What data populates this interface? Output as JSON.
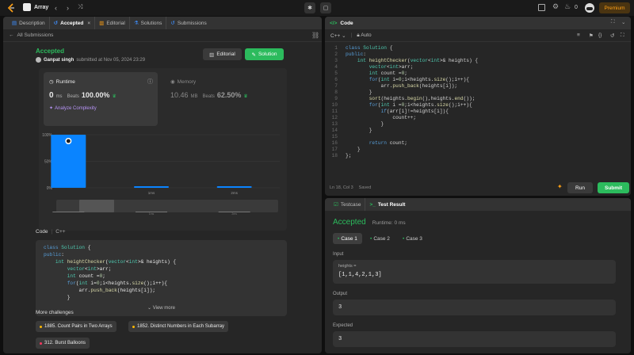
{
  "topbar": {
    "problem_list_label": "Array",
    "premium_label": "Premium",
    "fire_count": "0"
  },
  "left_panel": {
    "tabs": [
      {
        "label": "Description"
      },
      {
        "label": "Accepted"
      },
      {
        "label": "Editorial"
      },
      {
        "label": "Solutions"
      },
      {
        "label": "Submissions"
      }
    ],
    "back_label": "All Submissions",
    "status": "Accepted",
    "author": "Ganpat singh",
    "submitted_at": "submitted at Nov 05, 2024 23:29",
    "editorial_button": "Editorial",
    "solution_button": "Solution",
    "runtime": {
      "title": "Runtime",
      "value": "0",
      "unit": "ms",
      "beats_label": "Beats",
      "beats_value": "100.00%",
      "analyze_label": "Analyze Complexity"
    },
    "memory": {
      "title": "Memory",
      "value": "10.46",
      "unit": "MB",
      "beats_label": "Beats",
      "beats_value": "62.50%"
    },
    "code_label": "Code",
    "language": "C++",
    "code_preview": [
      "class Solution {",
      "public:",
      "    int heightChecker(vector<int>& heights) {",
      "        vector<int>arr;",
      "        int count =0;",
      "        for(int i=0;i<heights.size();i++){",
      "            arr.push_back(heights[i]);",
      "        }"
    ],
    "view_more": "View more",
    "more_challenges_title": "More challenges",
    "challenges": [
      "1885. Count Pairs in Two Arrays",
      "1852. Distinct Numbers in Each Subarray",
      "312. Burst Balloons"
    ]
  },
  "chart_data": {
    "type": "bar",
    "categories": [
      "",
      "1ms",
      "2ms"
    ],
    "values": [
      100,
      3,
      3
    ],
    "yticks": [
      "100%",
      "50%",
      "0%"
    ],
    "ylim": [
      0,
      100
    ]
  },
  "code_panel": {
    "title": "Code",
    "language": "C++",
    "mode": "Auto",
    "status_position": "Ln 18, Col 3",
    "status_saved": "Saved",
    "run_label": "Run",
    "submit_label": "Submit",
    "lines": [
      "class Solution {",
      "public:",
      "    int heightChecker(vector<int>& heights) {",
      "        vector<int>arr;",
      "        int count =0;",
      "        for(int i=0;i<heights.size();i++){",
      "            arr.push_back(heights[i]);",
      "        }",
      "        sort(heights.begin(),heights.end());",
      "        for(int i =0;i<heights.size();i++){",
      "            if(arr[i]!=heights[i]){",
      "                count++;",
      "            }",
      "        }",
      "",
      "        return count;",
      "    }",
      "};"
    ]
  },
  "result_panel": {
    "tabs": [
      {
        "label": "Testcase"
      },
      {
        "label": "Test Result"
      }
    ],
    "status": "Accepted",
    "runtime": "Runtime: 0 ms",
    "cases": [
      "Case 1",
      "Case 2",
      "Case 3"
    ],
    "input_label": "Input",
    "input_var": "heights =",
    "input_value": "[1,1,4,2,1,3]",
    "output_label": "Output",
    "output_value": "3",
    "expected_label": "Expected",
    "expected_value": "3"
  },
  "colors": {
    "accent_green": "#2cbb5d",
    "accent_orange": "#ffa116",
    "bar_blue": "#0a84ff"
  }
}
